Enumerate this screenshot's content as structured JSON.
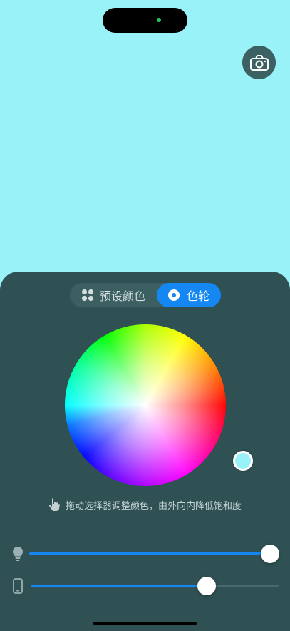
{
  "app": {
    "background_color": "#98F2F8",
    "accent_color": "#1487F2",
    "panel_color": "#2F5154"
  },
  "top": {
    "camera_icon": "camera-icon"
  },
  "mode_switch": {
    "preset_label": "预设颜色",
    "preset_icon": "grid-dots-icon",
    "wheel_label": "色轮",
    "wheel_icon": "target-icon",
    "selected": "色轮"
  },
  "color_wheel": {
    "selected_color": "#98F2F8"
  },
  "hint": {
    "icon": "hand-pointer-icon",
    "text": "拖动选择器调整颜色，由外向内降低饱和度"
  },
  "sliders": {
    "brightness": {
      "icon": "light-bulb-icon",
      "value_fraction": 1.0
    },
    "screen_brightness": {
      "icon": "phone-icon",
      "value_fraction": 0.72
    }
  }
}
